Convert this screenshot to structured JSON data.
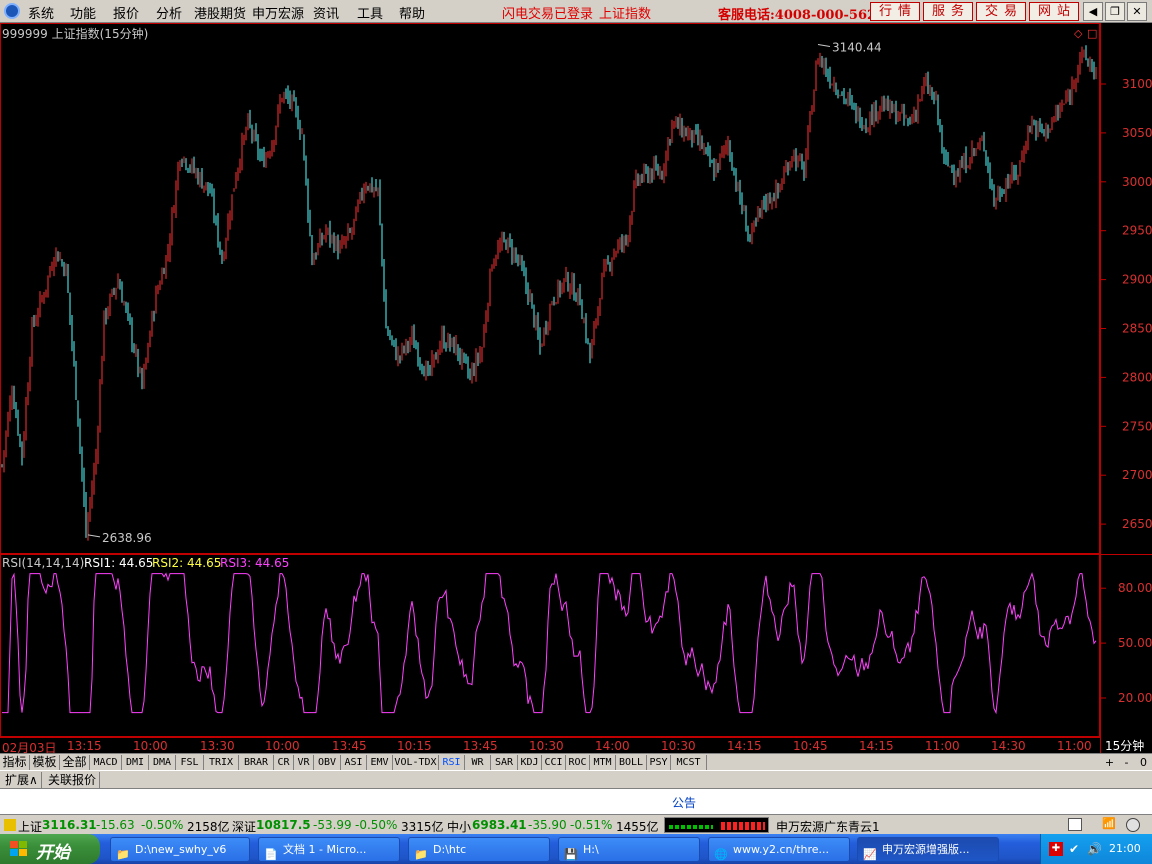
{
  "menu": {
    "items": [
      "系统",
      "功能",
      "报价",
      "分析",
      "港股期货",
      "申万宏源",
      "资讯",
      "工具",
      "帮助"
    ],
    "flash_login": "闪电交易已登录",
    "index_link": "上证指数",
    "hotline": "客服电话:4008-000-562",
    "services": [
      "行情",
      "服务",
      "交易",
      "网站"
    ]
  },
  "chart": {
    "title": "999999 上证指数(15分钟)",
    "high_label": "3140.44",
    "low_label": "2638.96",
    "price_ticks": [
      "3100",
      "3050",
      "3000",
      "2950",
      "2900",
      "2850",
      "2800",
      "2750",
      "2700",
      "2650"
    ],
    "rsi_header": "RSI(14,14,14)",
    "rsi1": "RSI1: 44.65",
    "rsi2": "RSI2: 44.65",
    "rsi3": "RSI3: 44.65",
    "rsi_ticks": [
      "80.00",
      "50.00",
      "20.00"
    ],
    "colors": {
      "up": "#ff3232",
      "down": "#54ffff",
      "rsi": "#ff40ff",
      "grid": "#c00000"
    }
  },
  "time_axis": [
    "02月03日",
    "13:15",
    "10:00",
    "13:30",
    "10:00",
    "13:45",
    "10:15",
    "13:45",
    "10:30",
    "14:00",
    "10:30",
    "14:15",
    "10:45",
    "14:15",
    "11:00",
    "14:30",
    "11:00"
  ],
  "period": "15分钟",
  "indicator_tabs": [
    "指标",
    "模板",
    "全部",
    "MACD",
    "DMI",
    "DMA",
    "FSL",
    "TRIX",
    "BRAR",
    "CR",
    "VR",
    "OBV",
    "ASI",
    "EMV",
    "VOL-TDX",
    "RSI",
    "WR",
    "SAR",
    "KDJ",
    "CCI",
    "ROC",
    "MTM",
    "BOLL",
    "PSY",
    "MCST"
  ],
  "active_indicator": "RSI",
  "indicator_controls": [
    "+",
    "-",
    "0"
  ],
  "ext_tabs": [
    "扩展∧",
    "关联报价"
  ],
  "announcement": "公告",
  "status": {
    "sh_label": "上证",
    "sh_value": "3116.31",
    "sh_change": "-15.63",
    "sh_pct": "-0.50%",
    "sh_amount": "2158亿",
    "sz_label": "深证",
    "sz_value": "10817.5",
    "sz_change": "-53.99",
    "sz_pct": "-0.50%",
    "sz_amount": "3315亿",
    "zx_label": "中小",
    "zx_value": "6983.41",
    "zx_change": "-35.90",
    "zx_pct": "-0.51%",
    "zx_amount": "1455亿",
    "broker": "申万宏源广东青云1"
  },
  "taskbar": {
    "start": "开始",
    "tasks": [
      "D:\\new_swhy_v6",
      "文档 1 - Micro...",
      "D:\\htc",
      "H:\\",
      "www.y2.cn/thre...",
      "申万宏源增强版..."
    ],
    "clock": "21:00"
  }
}
